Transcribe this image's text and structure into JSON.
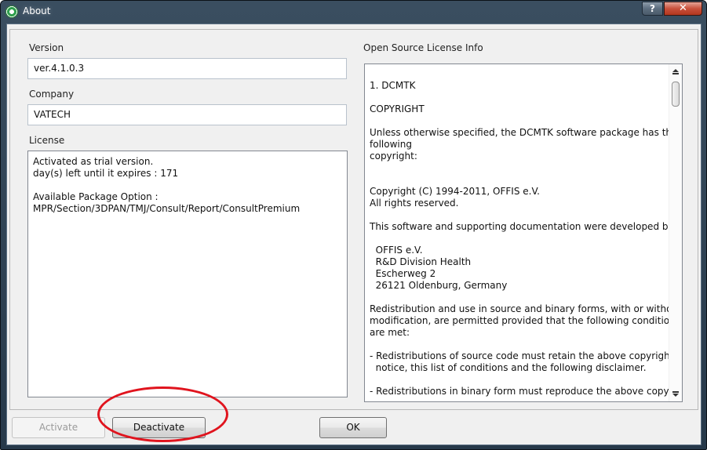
{
  "window": {
    "title": "About",
    "help_label": "?",
    "close_label": "✕"
  },
  "version": {
    "label": "Version",
    "value": "ver.4.1.0.3"
  },
  "company": {
    "label": "Company",
    "value": "VATECH"
  },
  "license": {
    "label": "License",
    "lines": [
      "Activated as trial version.",
      "day(s) left until it expires : 171",
      "",
      "Available Package Option :",
      "MPR/Section/3DPAN/TMJ/Consult/Report/ConsultPremium"
    ]
  },
  "oss": {
    "label": "Open Source License Info",
    "lines": [
      "1. DCMTK",
      "",
      "COPYRIGHT",
      "",
      "Unless otherwise specified, the DCMTK software package has the",
      "following",
      "copyright:",
      "",
      "",
      "Copyright (C) 1994-2011, OFFIS e.V.",
      "All rights reserved.",
      "",
      "This software and supporting documentation were developed by",
      "",
      "  OFFIS e.V.",
      "  R&D Division Health",
      "  Escherweg 2",
      "  26121 Oldenburg, Germany",
      "",
      "Redistribution and use in source and binary forms, with or without",
      "modification, are permitted provided that the following conditions",
      "are met:",
      "",
      "- Redistributions of source code must retain the above copyright",
      "  notice, this list of conditions and the following disclaimer.",
      "",
      "- Redistributions in binary form must reproduce the above copyright"
    ]
  },
  "buttons": {
    "activate": "Activate",
    "deactivate": "Deactivate",
    "ok": "OK"
  },
  "colors": {
    "annotation": "#e0141e",
    "close_button": "#c9503b",
    "titlebar": "#2f4253"
  }
}
